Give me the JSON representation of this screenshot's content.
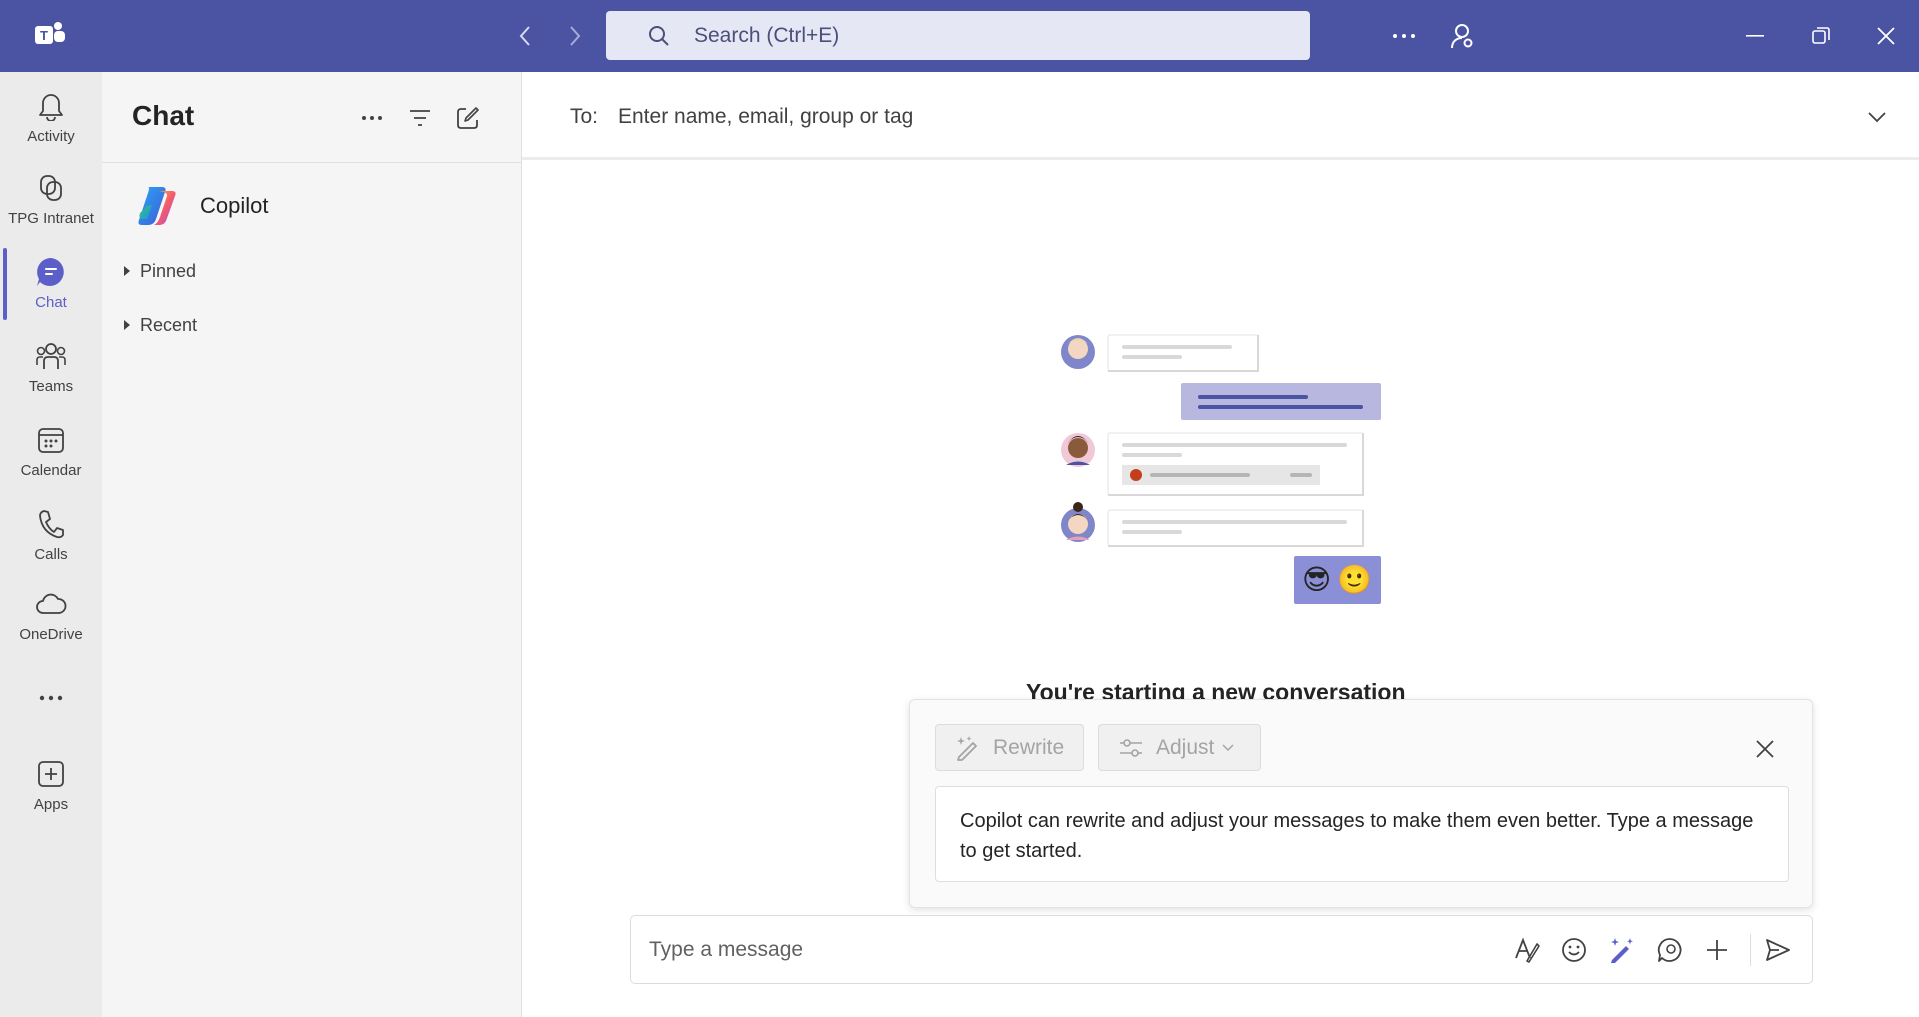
{
  "titlebar": {
    "app_icon": "teams-logo-icon",
    "back_icon": "chevron-left-icon",
    "forward_icon": "chevron-right-icon",
    "search": {
      "placeholder": "Search (Ctrl+E)",
      "icon": "search-icon"
    },
    "more_icon": "more-horizontal-icon",
    "account_icon": "person-settings-icon",
    "window_controls": [
      "minimize-icon",
      "restore-icon",
      "close-icon"
    ],
    "color": "#4b53a3"
  },
  "rail": {
    "items": [
      {
        "label": "Activity",
        "icon": "bell-icon",
        "active": false
      },
      {
        "label": "TPG Intranet",
        "icon": "link-app-icon",
        "active": false
      },
      {
        "label": "Chat",
        "icon": "chat-icon",
        "active": true
      },
      {
        "label": "Teams",
        "icon": "people-group-icon",
        "active": false
      },
      {
        "label": "Calendar",
        "icon": "calendar-icon",
        "active": false
      },
      {
        "label": "Calls",
        "icon": "phone-icon",
        "active": false
      },
      {
        "label": "OneDrive",
        "icon": "cloud-icon",
        "active": false
      },
      {
        "label": "",
        "icon": "more-horizontal-icon",
        "active": false
      },
      {
        "label": "Apps",
        "icon": "add-square-icon",
        "active": false
      }
    ],
    "accent": "#5b5fc7"
  },
  "chatpane": {
    "title": "Chat",
    "copilot": {
      "name": "Copilot"
    },
    "sections": [
      {
        "label": "Pinned"
      },
      {
        "label": "Recent"
      }
    ]
  },
  "main": {
    "to_label": "To:",
    "to_placeholder": "Enter name, email, group or tag",
    "new_conversation": "You're starting a new conversation",
    "illustration_emojis": "😎🙂"
  },
  "copilot_popup": {
    "rewrite_label": "Rewrite",
    "adjust_label": "Adjust",
    "message": "Copilot can rewrite and adjust your messages to make them even better. Type a message to get started."
  },
  "compose": {
    "placeholder": "Type a message",
    "icons": [
      "format-icon",
      "emoji-icon",
      "copilot-rewrite-icon",
      "loop-icon",
      "attach-plus-icon",
      "send-icon"
    ]
  }
}
